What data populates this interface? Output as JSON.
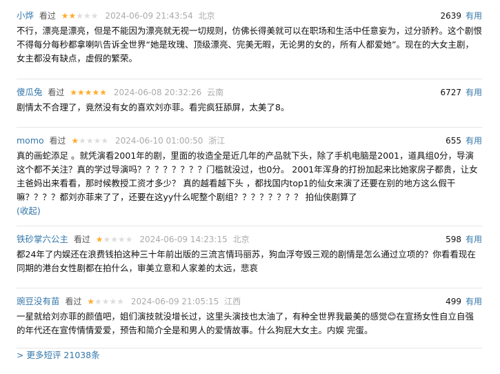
{
  "reviews": [
    {
      "user": "小烨",
      "watched": "看过",
      "rating": 2,
      "time": "2024-06-09 21:43:54",
      "location": "北京",
      "votes": "2639",
      "useful": "有用",
      "content": "不行，漂亮是漂亮，但是不能因为漂亮就无视一切规则，仿佛长得美就可以在职场和生活中任意妄为，过分骄矜。这个剧恨不得每分每秒都拿喇叭告诉全世界“她是玫瑰、顶级漂亮、完美无暇，无论男的女的，所有人都爱她”。现在的大女主剧，女主都没有缺点，虚假的繁荣。"
    },
    {
      "user": "傻瓜兔",
      "watched": "看过",
      "rating": 5,
      "time": "2024-06-08 20:32:26",
      "location": "云南",
      "votes": "6727",
      "useful": "有用",
      "content": "剧情太不合理了，竟然没有女的喜欢刘亦菲。看完疯狂舔屏，太美了8。"
    },
    {
      "user": "momo",
      "watched": "看过",
      "rating": 1,
      "time": "2024-06-10 01:00:50",
      "location": "浙江",
      "votes": "655",
      "useful": "有用",
      "content": "真的画蛇添足 。就凭演看2001年的剧，里面的妆造全是近几年的产品就下头，除了手机电脑是2001，道具组0分，导演这个都不关注？真的学过导演吗？？？？？？？？门槛就没过，也0分。 2001年浑身的打扮加起来比她家房子都贵，让女主爸妈出来看看，那时候教授工资才多少？ 真的越看越下头 ，都找国内top1的仙女来演了还要在别的地方这么假干嘛？？？？都刘亦菲来了了，还要在这yy什么呢整个剧组？？？？？？？？ 拍仙侠剧算了",
      "collapse": "(收起)"
    },
    {
      "user": "铁砂掌六公主",
      "watched": "看过",
      "rating": 1,
      "time": "2024-06-09 14:23:15",
      "location": "北京",
      "votes": "598",
      "useful": "有用",
      "content": "都24年了内娱还在浪费钱拍这种三十年前出版的三流言情玛丽苏，狗血浮夸毁三观的剧情是怎么通过立项的？你看看现在同期的港台女性剧都在拍什么，审美立意和人家差的太远，悲哀"
    },
    {
      "user": "豌豆没有苗",
      "watched": "看过",
      "rating": 1,
      "time": "2024-06-09 21:05:15",
      "location": "江西",
      "votes": "499",
      "useful": "有用",
      "content": "一星就给刘亦菲的颜值吧，姐们演技就没增长过，这里头演技也太油了，有种全世界我最美的感觉😊在宣扬女性自立自强的年代还在宣传情情爱爱，预告和简介全是和男人的爱情故事。什么狗屁大女主。内娱 完蛋。"
    }
  ],
  "more_link": "> 更多短评 21038条",
  "colors": {
    "link": "#3377aa",
    "star_on": "#ffac2d",
    "star_off": "#dddddd",
    "meta_gray": "#aaaaaa"
  }
}
